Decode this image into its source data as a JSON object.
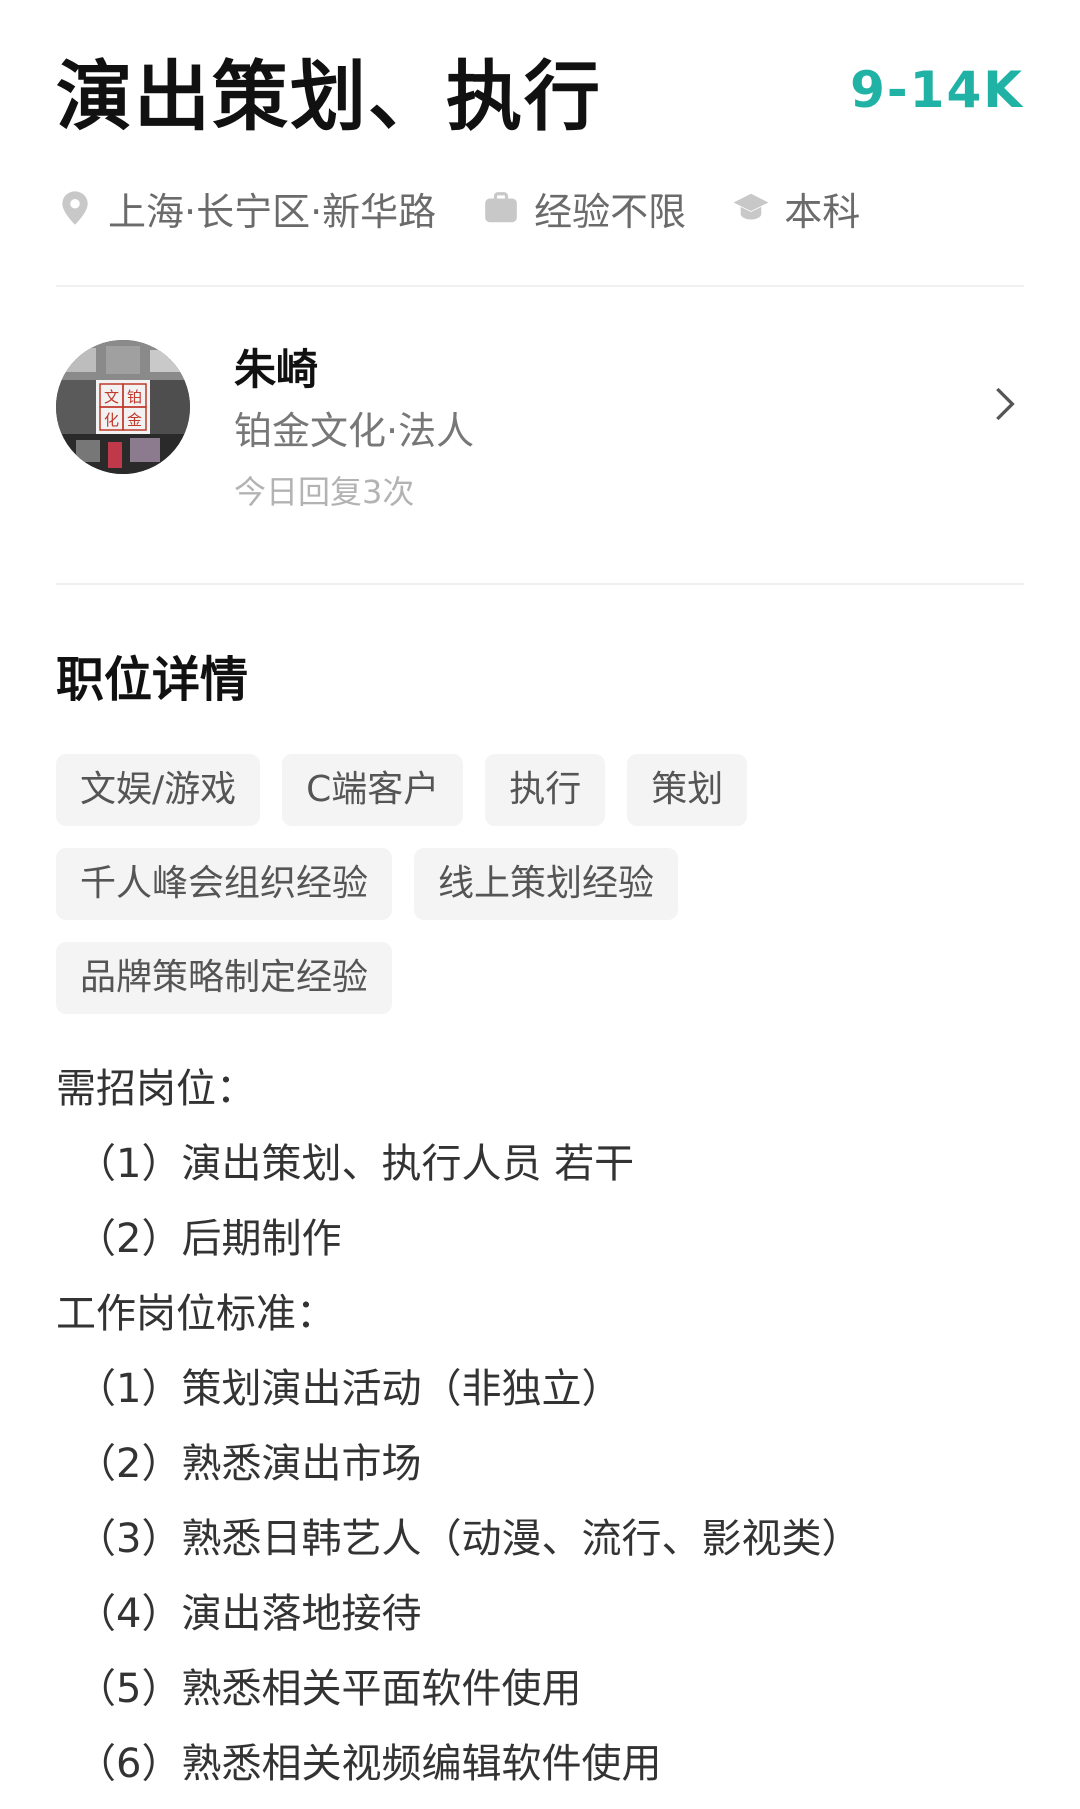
{
  "job": {
    "title": "演出策划、执行",
    "salary": "9-14K",
    "location": "上海·长宁区·新华路",
    "experience": "经验不限",
    "education": "本科"
  },
  "icons": {
    "location": "location-pin-icon",
    "experience": "briefcase-icon",
    "education": "graduation-cap-icon",
    "chevron": "chevron-right-icon"
  },
  "recruiter": {
    "name": "朱崎",
    "company_role": "铂金文化·法人",
    "reply_info": "今日回复3次",
    "avatar_text": [
      "文",
      "铂",
      "化",
      "金"
    ]
  },
  "details": {
    "section_title": "职位详情",
    "tags": [
      "文娱/游戏",
      "C端客户",
      "执行",
      "策划",
      "千人峰会组织经验",
      "线上策划经验",
      "品牌策略制定经验"
    ],
    "lines": [
      {
        "text": "需招岗位：",
        "indent": false
      },
      {
        "text": "（1）演出策划、执行人员 若干",
        "indent": true
      },
      {
        "text": "（2）后期制作",
        "indent": true
      },
      {
        "text": "工作岗位标准：",
        "indent": false
      },
      {
        "text": "（1）策划演出活动（非独立）",
        "indent": true
      },
      {
        "text": "（2）熟悉演出市场",
        "indent": true
      },
      {
        "text": "（3）熟悉日韩艺人（动漫、流行、影视类）",
        "indent": true
      },
      {
        "text": "（4）演出落地接待",
        "indent": true
      },
      {
        "text": "（5）熟悉相关平面软件使用",
        "indent": true
      },
      {
        "text": "（6）熟悉相关视频编辑软件使用",
        "indent": true
      }
    ]
  },
  "colors": {
    "salary": "#1fb2a5",
    "tag_bg": "#f4f4f4"
  }
}
